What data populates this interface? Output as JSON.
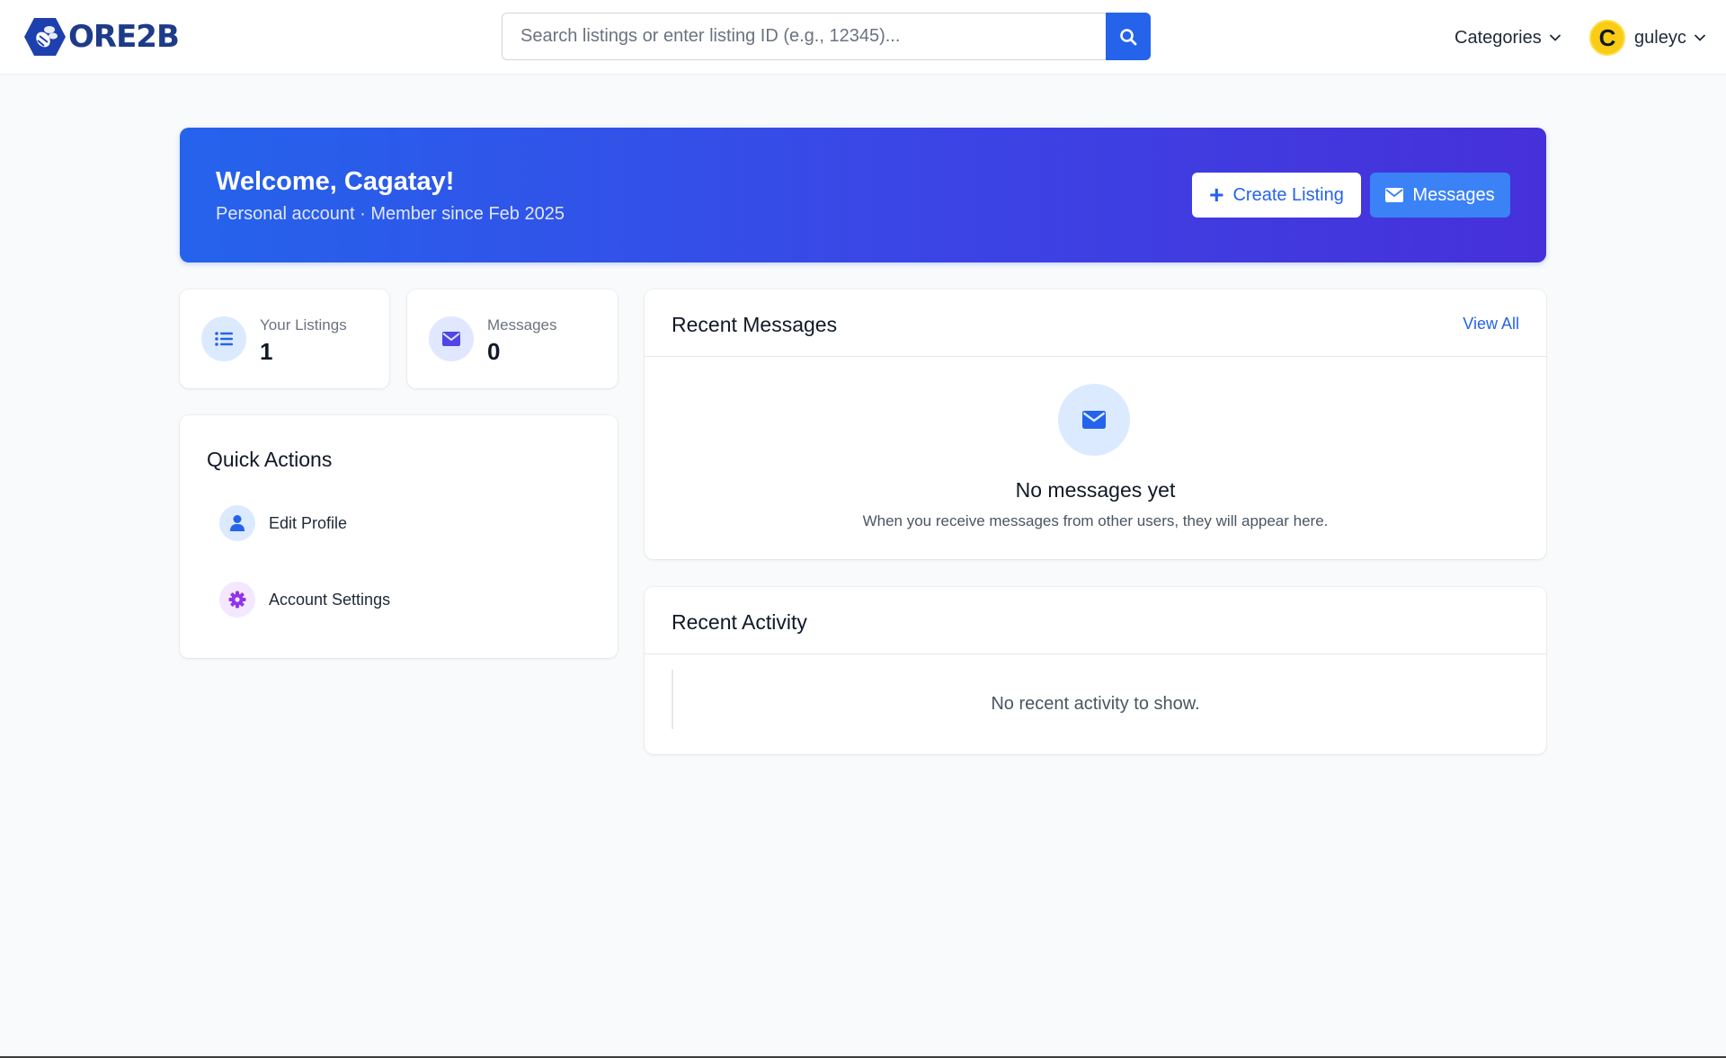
{
  "header": {
    "logo_text": "ORE2B",
    "search": {
      "placeholder": "Search listings or enter listing ID (e.g., 12345)...",
      "value": ""
    },
    "categories_label": "Categories",
    "user": {
      "avatar_letter": "C",
      "username": "guleyc"
    }
  },
  "banner": {
    "title": "Welcome, Cagatay!",
    "subtitle": "Personal account · Member since Feb 2025",
    "create_label": "Create Listing",
    "messages_label": "Messages"
  },
  "stats": [
    {
      "label": "Your Listings",
      "value": "1",
      "icon": "list-icon"
    },
    {
      "label": "Messages",
      "value": "0",
      "icon": "envelope-icon"
    }
  ],
  "quick_actions": {
    "title": "Quick Actions",
    "items": [
      {
        "label": "Edit Profile",
        "icon": "user-icon"
      },
      {
        "label": "Account Settings",
        "icon": "gear-icon"
      }
    ]
  },
  "recent_messages": {
    "title": "Recent Messages",
    "view_all": "View All",
    "empty_title": "No messages yet",
    "empty_text": "When you receive messages from other users, they will appear here."
  },
  "recent_activity": {
    "title": "Recent Activity",
    "empty_text": "No recent activity to show."
  },
  "colors": {
    "primary": "#2563eb",
    "banner_end": "#4630d9",
    "avatar": "#facc15",
    "settings_accent": "#9333ea"
  }
}
